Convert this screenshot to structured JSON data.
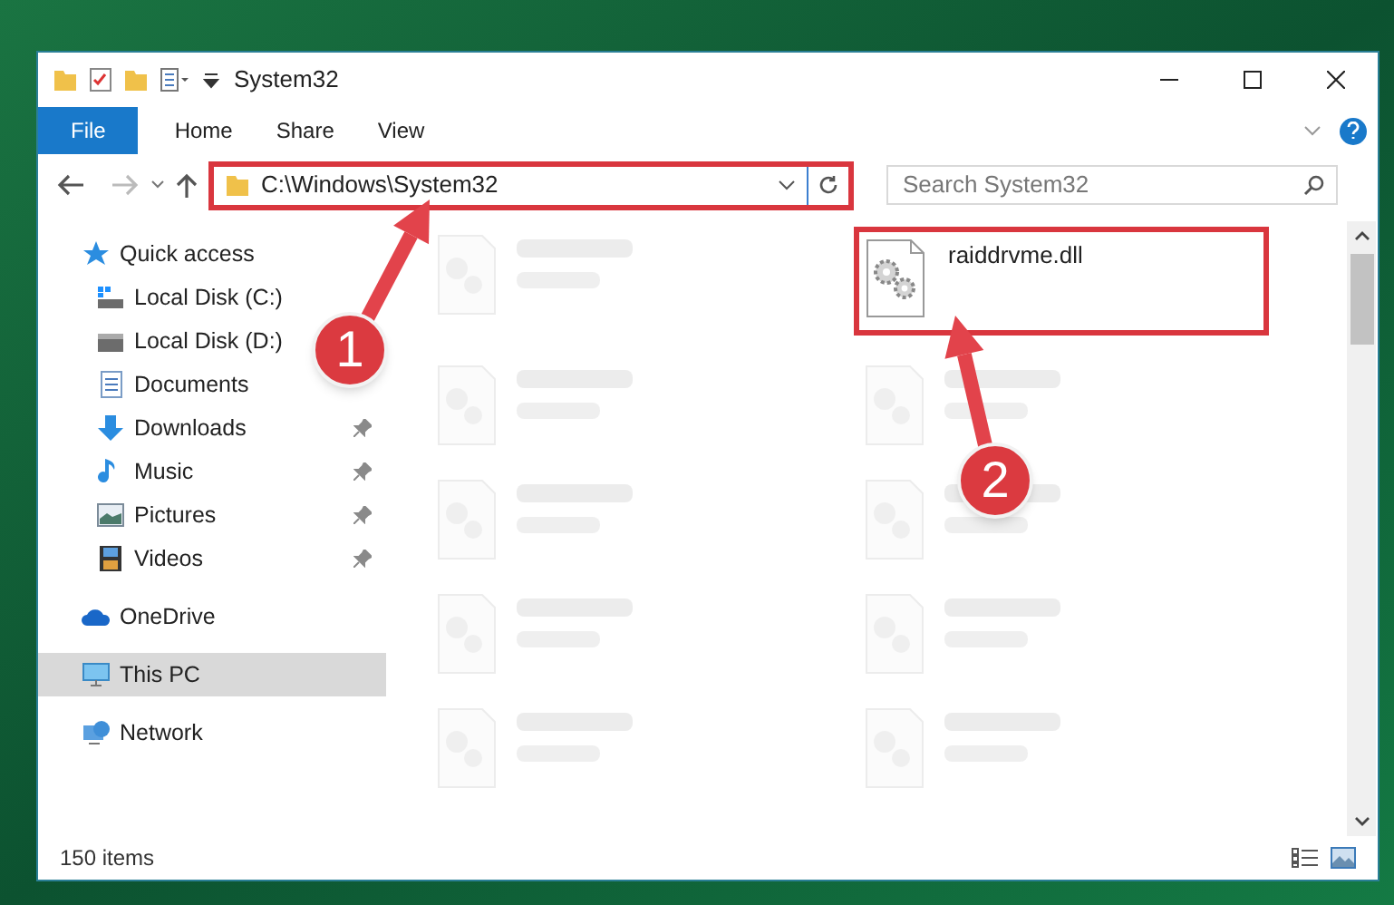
{
  "window": {
    "title": "System32"
  },
  "ribbon": {
    "tabs": [
      {
        "label": "File",
        "selected": true
      },
      {
        "label": "Home",
        "selected": false
      },
      {
        "label": "Share",
        "selected": false
      },
      {
        "label": "View",
        "selected": false
      }
    ]
  },
  "address_bar": {
    "path": "C:\\Windows\\System32",
    "search_placeholder": "Search System32",
    "highlighted": true
  },
  "sidebar": {
    "items": [
      {
        "label": "Quick access",
        "kind": "star",
        "selected": false,
        "children": [
          {
            "label": "Local Disk (C:)",
            "kind": "system-disk",
            "pinned": false
          },
          {
            "label": "Local Disk (D:)",
            "kind": "disk",
            "pinned": false
          },
          {
            "label": "Documents",
            "kind": "documents",
            "pinned": false
          },
          {
            "label": "Downloads",
            "kind": "downloads",
            "pinned": true
          },
          {
            "label": "Music",
            "kind": "music",
            "pinned": true
          },
          {
            "label": "Pictures",
            "kind": "pictures",
            "pinned": true
          },
          {
            "label": "Videos",
            "kind": "videos",
            "pinned": true
          }
        ]
      },
      {
        "label": "OneDrive",
        "kind": "cloud",
        "selected": false
      },
      {
        "label": "This PC",
        "kind": "pc",
        "selected": true
      },
      {
        "label": "Network",
        "kind": "network",
        "selected": false
      }
    ]
  },
  "files": [
    {
      "faded": true
    },
    {
      "name": "raiddrvme.dll",
      "faded": false,
      "highlighted": true
    },
    {
      "faded": true
    },
    {
      "faded": true
    },
    {
      "faded": true
    },
    {
      "faded": true
    },
    {
      "faded": true
    },
    {
      "faded": true
    },
    {
      "faded": true
    },
    {
      "faded": true
    }
  ],
  "status_bar": {
    "item_count": "150 items"
  },
  "annotations": [
    {
      "number": "1"
    },
    {
      "number": "2"
    }
  ]
}
